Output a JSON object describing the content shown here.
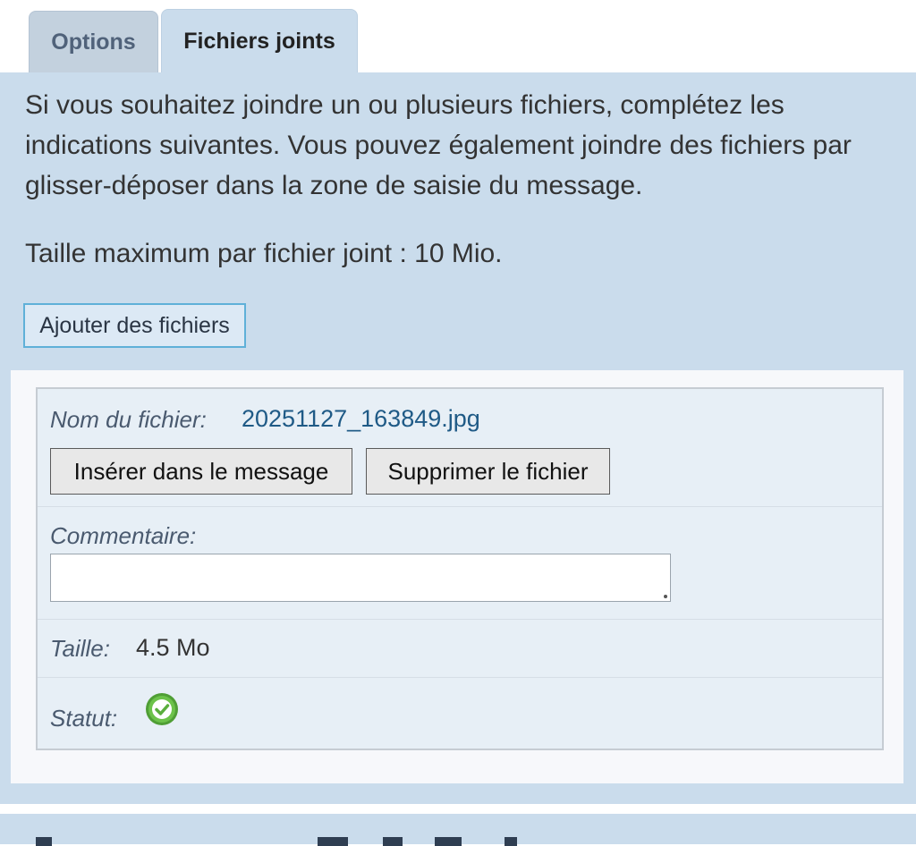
{
  "tabs": [
    {
      "label": "Options"
    },
    {
      "label": "Fichiers joints"
    }
  ],
  "intro_text": "Si vous souhaitez joindre un ou plusieurs fichiers, complétez les indications suivantes. Vous pouvez également joindre des fichiers par glisser-déposer dans la zone de saisie du message.",
  "max_size_text": "Taille maximum par fichier joint : 10 Mio.",
  "add_files_label": "Ajouter des fichiers",
  "attachment": {
    "filename_label": "Nom du fichier:",
    "filename": "20251127_163849.jpg",
    "insert_label": "Insérer dans le message",
    "delete_label": "Supprimer le fichier",
    "comment_label": "Commentaire:",
    "comment_value": "",
    "size_label": "Taille:",
    "size_value": "4.5 Mo",
    "status_label": "Statut:",
    "status_icon": "check-circle-icon"
  },
  "colors": {
    "panel_bg": "#cadcec",
    "status_green": "#5db53a"
  }
}
